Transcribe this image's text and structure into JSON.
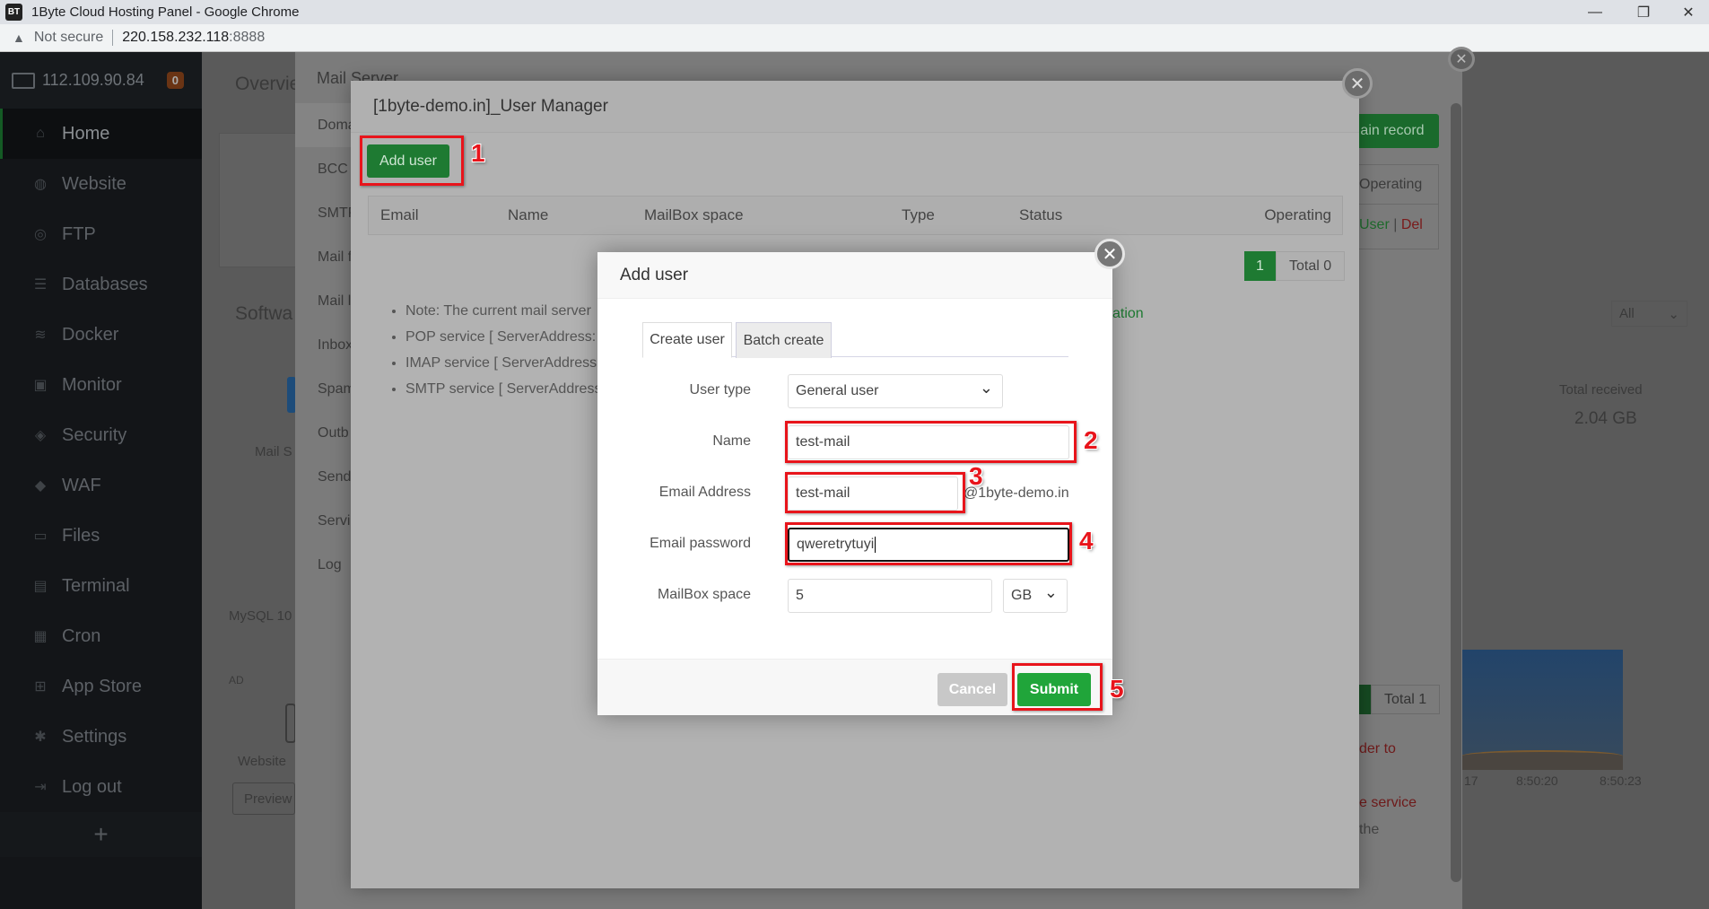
{
  "browser": {
    "window_title": "1Byte Cloud Hosting Panel - Google Chrome",
    "app_icon": "BT",
    "security_label": "Not secure",
    "url_host": "220.158.232.118",
    "url_port": ":8888"
  },
  "sidebar": {
    "server_ip": "112.109.90.84",
    "notification_count": "0",
    "items": [
      {
        "label": "Home",
        "icon": "home-icon",
        "active": true
      },
      {
        "label": "Website",
        "icon": "globe-icon"
      },
      {
        "label": "FTP",
        "icon": "ftp-icon"
      },
      {
        "label": "Databases",
        "icon": "database-icon"
      },
      {
        "label": "Docker",
        "icon": "docker-icon"
      },
      {
        "label": "Monitor",
        "icon": "monitor-icon"
      },
      {
        "label": "Security",
        "icon": "shield-icon"
      },
      {
        "label": "WAF",
        "icon": "waf-icon"
      },
      {
        "label": "Files",
        "icon": "folder-icon"
      },
      {
        "label": "Terminal",
        "icon": "terminal-icon"
      },
      {
        "label": "Cron",
        "icon": "calendar-icon"
      },
      {
        "label": "App Store",
        "icon": "grid-icon"
      },
      {
        "label": "Settings",
        "icon": "gear-icon"
      },
      {
        "label": "Log out",
        "icon": "logout-icon"
      }
    ],
    "add_label": "+"
  },
  "background_page": {
    "overview_title": "Overvie",
    "software_title": "Softwa",
    "mail_server_label": "Mail S",
    "mysql_label": "MySQL 10",
    "ad_label": "AD",
    "website_label": "Website",
    "preview_label": "Preview",
    "filter_select": "All",
    "total_received_label": "Total received",
    "total_received_value": "2.04 GB",
    "chart_ticks": [
      "17",
      "8:50:20",
      "8:50:23"
    ]
  },
  "mail_server": {
    "title": "Mail Server",
    "menu": [
      "Doma",
      "BCC",
      "SMTP",
      "Mail f",
      "Mail l",
      "Inbox",
      "Spam",
      "Outb",
      "Send",
      "Servi",
      "Log"
    ],
    "domain_record_btn": "ain record",
    "table_operating": "Operating",
    "row_user_link": "User",
    "row_del_link": "Del",
    "pager_total": "Total 1",
    "warning_fragment_1": "der to",
    "warning_fragment_2": "e service",
    "warning_fragment_3": "the"
  },
  "user_manager": {
    "title": "[1byte-demo.in]_User Manager",
    "add_user_btn": "Add user",
    "columns": [
      "Email",
      "Name",
      "MailBox space",
      "Type",
      "Status",
      "Operating"
    ],
    "pager_current": "1",
    "pager_total": "Total 0",
    "notes": [
      "Note: The current mail server",
      "POP service [ ServerAddress:",
      "IMAP service [ ServerAddress",
      "SMTP service [ ServerAddress"
    ],
    "notes_link_fragment": "ation"
  },
  "add_user_dialog": {
    "title": "Add user",
    "tabs": [
      {
        "label": "Create user",
        "active": true
      },
      {
        "label": "Batch create",
        "active": false
      }
    ],
    "fields": {
      "user_type": {
        "label": "User type",
        "value": "General user"
      },
      "name": {
        "label": "Name",
        "value": "test-mail"
      },
      "email": {
        "label": "Email Address",
        "value": "test-mail",
        "suffix": "@1byte-demo.in"
      },
      "password": {
        "label": "Email password",
        "value": "qweretrytuyi"
      },
      "mailbox_space": {
        "label": "MailBox space",
        "value": "5",
        "unit": "GB"
      }
    },
    "cancel_btn": "Cancel",
    "submit_btn": "Submit"
  },
  "annotations": [
    "1",
    "2",
    "3",
    "4",
    "5"
  ],
  "colors": {
    "accent_green": "#20a53a",
    "annotation_red": "#e8141b"
  }
}
